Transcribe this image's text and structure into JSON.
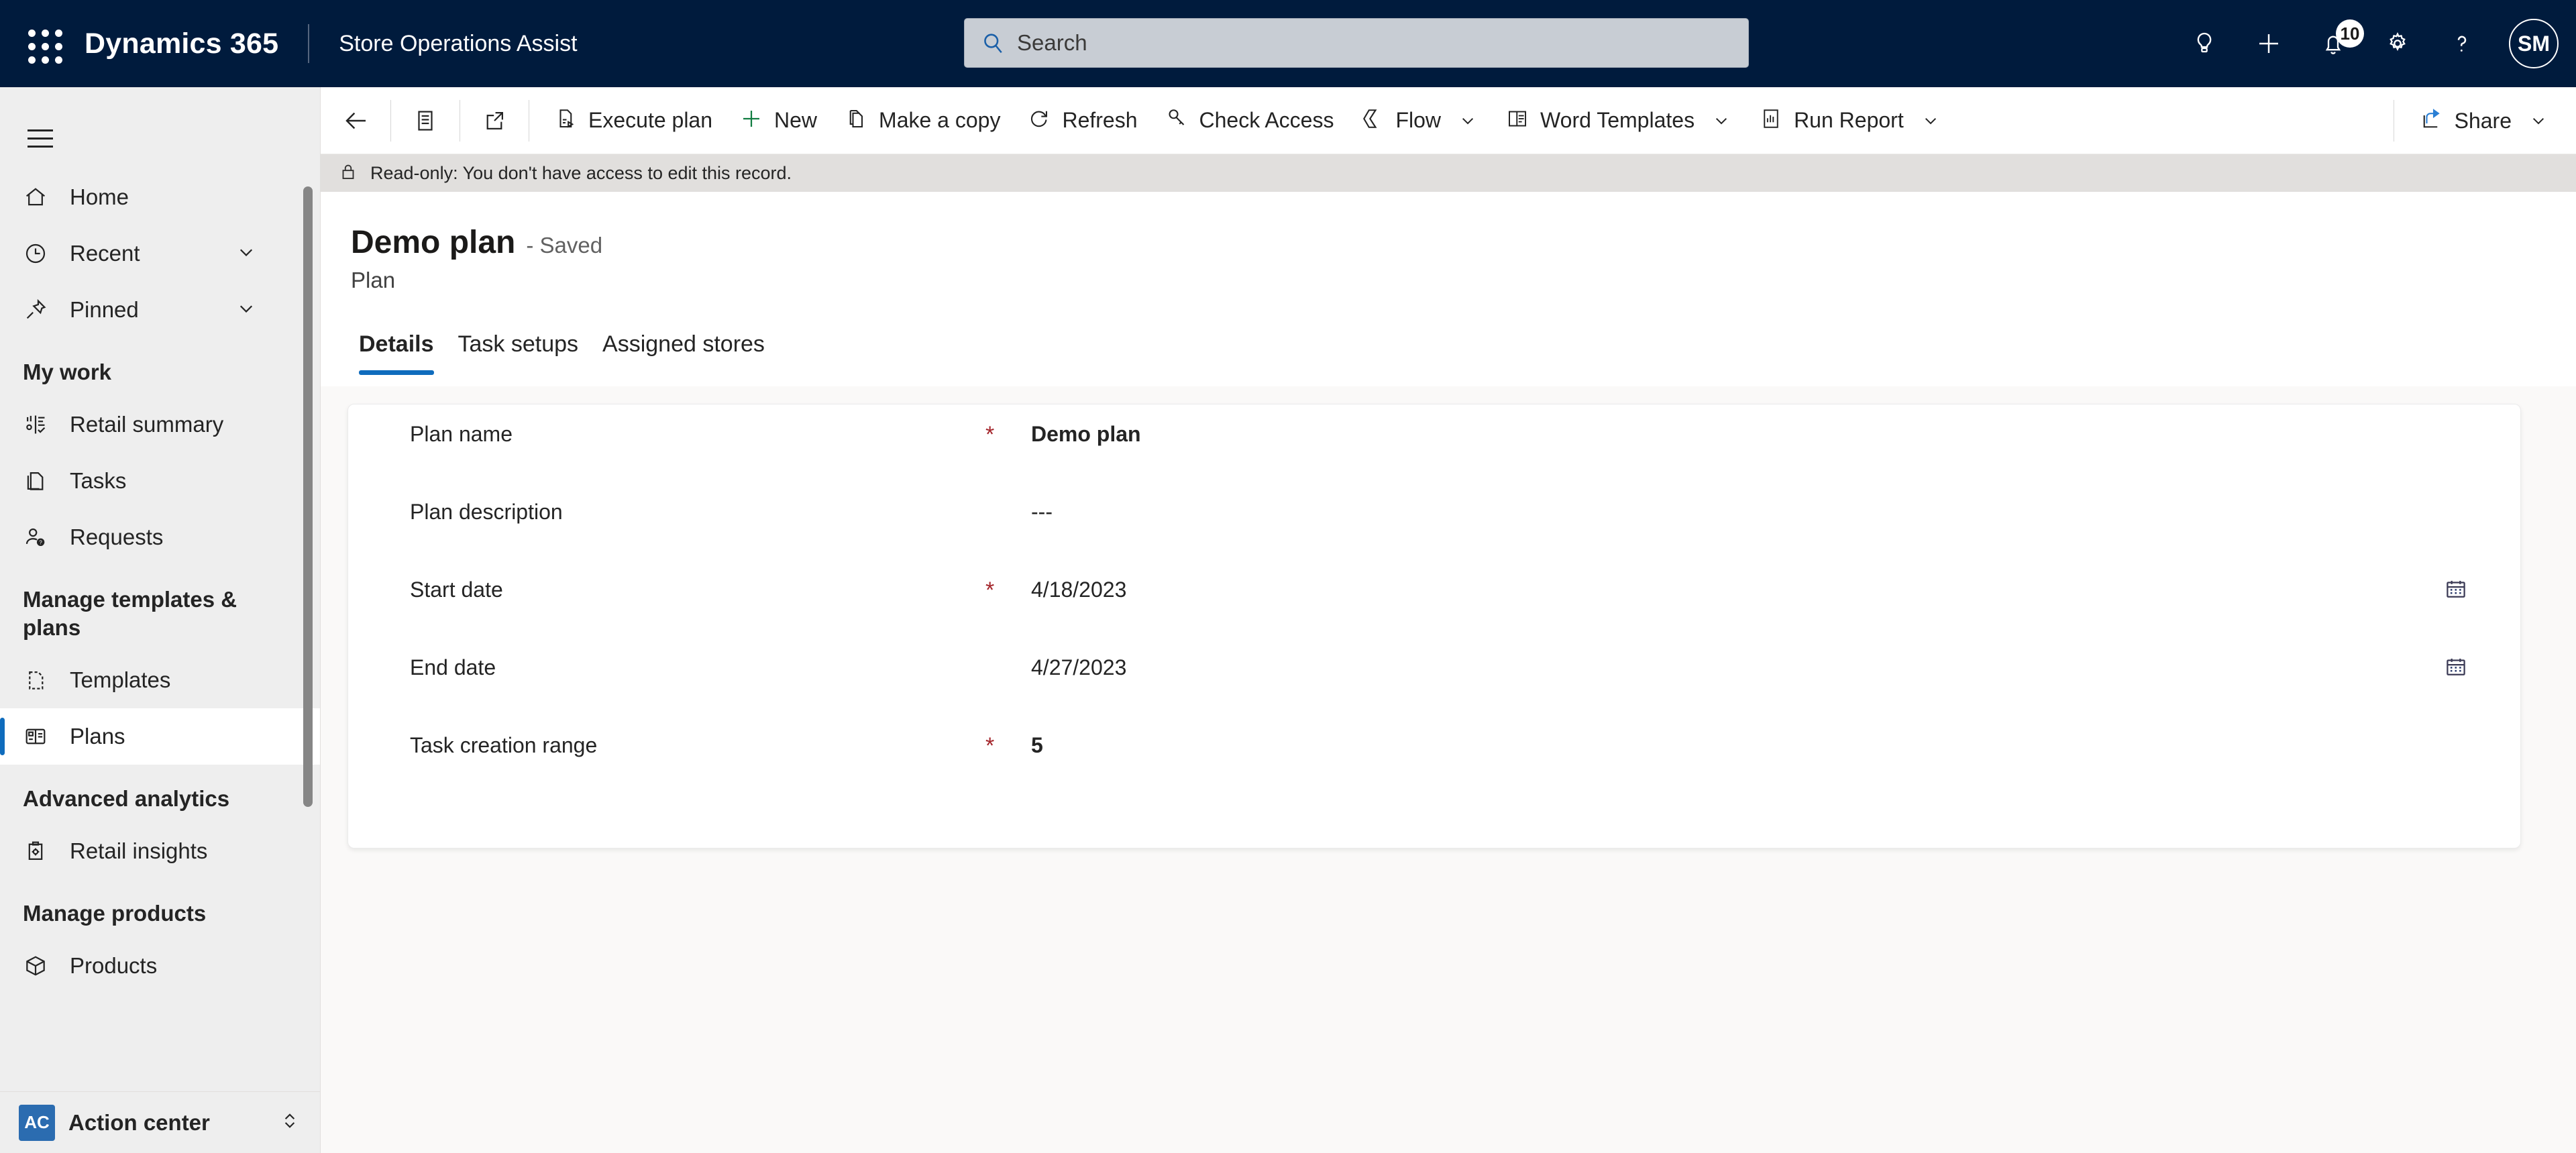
{
  "topbar": {
    "waffle_icon": "app-launcher-icon",
    "brand": "Dynamics 365",
    "app_name": "Store Operations Assist",
    "search": {
      "placeholder": "Search",
      "value": "",
      "icon": "search-icon"
    },
    "actions": [
      {
        "name": "lightbulb-icon",
        "label": "Lightbulb"
      },
      {
        "name": "plus-icon",
        "label": "New"
      },
      {
        "name": "bell-icon",
        "label": "Notifications",
        "badge": "10"
      },
      {
        "name": "gear-icon",
        "label": "Settings"
      },
      {
        "name": "question-icon",
        "label": "Help"
      }
    ],
    "avatar_initials": "SM"
  },
  "sidebar": {
    "hamburger_icon": "hamburger-menu-icon",
    "items": [
      {
        "label": "Home",
        "icon": "home-icon",
        "type": "item",
        "expandable": false,
        "selected": false
      },
      {
        "label": "Recent",
        "icon": "clock-icon",
        "type": "item",
        "expandable": true,
        "selected": false
      },
      {
        "label": "Pinned",
        "icon": "pin-icon",
        "type": "item",
        "expandable": true,
        "selected": false
      },
      {
        "label": "My work",
        "type": "group"
      },
      {
        "label": "Retail summary",
        "icon": "chart-icon",
        "type": "item",
        "expandable": false,
        "selected": false
      },
      {
        "label": "Tasks",
        "icon": "pages-icon",
        "type": "item",
        "expandable": false,
        "selected": false
      },
      {
        "label": "Requests",
        "icon": "person-question-icon",
        "type": "item",
        "expandable": false,
        "selected": false
      },
      {
        "label": "Manage templates & plans",
        "type": "group"
      },
      {
        "label": "Templates",
        "icon": "template-icon",
        "type": "item",
        "expandable": false,
        "selected": false
      },
      {
        "label": "Plans",
        "icon": "plan-grid-icon",
        "type": "item",
        "expandable": false,
        "selected": true
      },
      {
        "label": "Advanced analytics",
        "type": "group"
      },
      {
        "label": "Retail insights",
        "icon": "clipboard-gear-icon",
        "type": "item",
        "expandable": false,
        "selected": false
      },
      {
        "label": "Manage products",
        "type": "group"
      },
      {
        "label": "Products",
        "icon": "box-icon",
        "type": "item",
        "expandable": false,
        "selected": false
      }
    ],
    "action_center": {
      "badge": "AC",
      "label": "Action center",
      "chevron_icon": "chevron-up-down-icon"
    }
  },
  "commandbar": {
    "back_icon": "arrow-left-icon",
    "form_selector_icon": "form-list-icon",
    "popout_icon": "pop-out-icon",
    "buttons": [
      {
        "label": "Execute plan",
        "icon": "execute-plan-icon",
        "has_chevron": false
      },
      {
        "label": "New",
        "icon": "plus-icon",
        "has_chevron": false
      },
      {
        "label": "Make a copy",
        "icon": "copy-icon",
        "has_chevron": false
      },
      {
        "label": "Refresh",
        "icon": "refresh-icon",
        "has_chevron": false
      },
      {
        "label": "Check Access",
        "icon": "key-icon",
        "has_chevron": false
      },
      {
        "label": "Flow",
        "icon": "flow-icon",
        "has_chevron": true
      },
      {
        "label": "Word Templates",
        "icon": "word-icon",
        "has_chevron": true
      },
      {
        "label": "Run Report",
        "icon": "report-icon",
        "has_chevron": true
      }
    ],
    "share": {
      "label": "Share",
      "icon": "share-icon",
      "has_chevron": true
    }
  },
  "notification": {
    "icon": "lock-icon",
    "text": "Read-only: You don't have access to edit this record."
  },
  "page": {
    "title": "Demo plan",
    "saved_status": "- Saved",
    "entity": "Plan",
    "tabs": [
      {
        "label": "Details",
        "active": true
      },
      {
        "label": "Task setups",
        "active": false
      },
      {
        "label": "Assigned stores",
        "active": false
      }
    ]
  },
  "form": {
    "fields": [
      {
        "label": "Plan name",
        "required": true,
        "value": "Demo plan",
        "bold": true,
        "calendar": false
      },
      {
        "label": "Plan description",
        "required": false,
        "value": "---",
        "bold": false,
        "calendar": false
      },
      {
        "label": "Start date",
        "required": true,
        "value": "4/18/2023",
        "bold": false,
        "calendar": true
      },
      {
        "label": "End date",
        "required": false,
        "value": "4/27/2023",
        "bold": false,
        "calendar": true
      },
      {
        "label": "Task creation range",
        "required": true,
        "value": "5",
        "bold": true,
        "calendar": false
      }
    ],
    "required_marker": "*",
    "calendar_icon": "calendar-icon"
  },
  "colors": {
    "topbar_bg": "#001b3d",
    "accent": "#0f6cbd",
    "required_red": "#a4262c",
    "sidebar_bg": "#eeeeee",
    "canvas_bg": "#faf9f8",
    "notification_bg": "#e1dfdd"
  }
}
